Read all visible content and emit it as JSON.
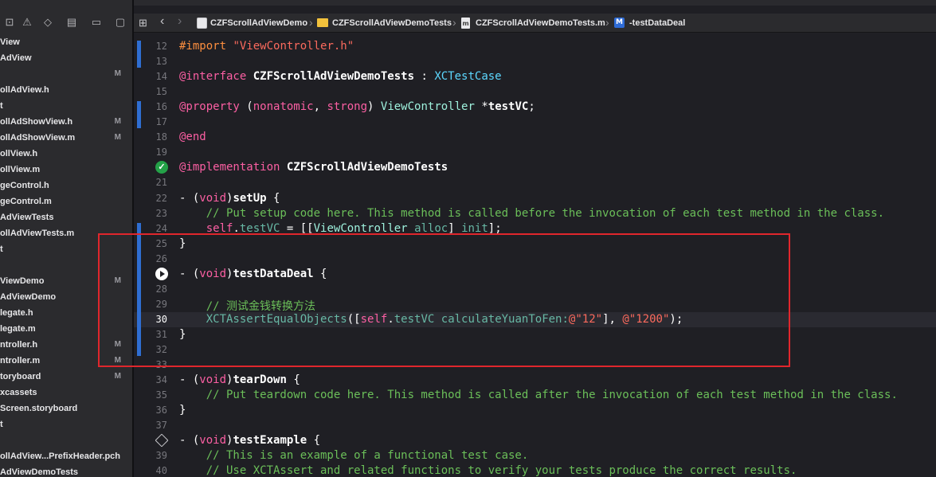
{
  "navigator": {
    "files": [
      {
        "label": "View",
        "status": ""
      },
      {
        "label": "AdView",
        "status": ""
      },
      {
        "label": "",
        "status": "M"
      },
      {
        "label": "ollAdView.h",
        "status": ""
      },
      {
        "label": "t",
        "status": ""
      },
      {
        "label": "ollAdShowView.h",
        "status": "M"
      },
      {
        "label": "ollAdShowView.m",
        "status": "M"
      },
      {
        "label": "ollView.h",
        "status": ""
      },
      {
        "label": "ollView.m",
        "status": ""
      },
      {
        "label": "geControl.h",
        "status": ""
      },
      {
        "label": "geControl.m",
        "status": ""
      },
      {
        "label": "AdViewTests",
        "status": ""
      },
      {
        "label": "ollAdViewTests.m",
        "status": ""
      },
      {
        "label": "t",
        "status": ""
      },
      {
        "label": "",
        "status": ""
      },
      {
        "label": "ViewDemo",
        "status": "M"
      },
      {
        "label": "AdViewDemo",
        "status": ""
      },
      {
        "label": "legate.h",
        "status": ""
      },
      {
        "label": "legate.m",
        "status": ""
      },
      {
        "label": "ntroller.h",
        "status": "M"
      },
      {
        "label": "ntroller.m",
        "status": "M"
      },
      {
        "label": "toryboard",
        "status": "M"
      },
      {
        "label": "xcassets",
        "status": ""
      },
      {
        "label": "Screen.storyboard",
        "status": ""
      },
      {
        "label": "t",
        "status": ""
      },
      {
        "label": "",
        "status": ""
      },
      {
        "label": "ollAdView...PrefixHeader.pch",
        "status": ""
      },
      {
        "label": "AdViewDemoTests",
        "status": ""
      }
    ]
  },
  "jumpbar": {
    "project": "CZFScrollAdViewDemo",
    "folder": "CZFScrollAdViewDemoTests",
    "file": "CZFScrollAdViewDemoTests.m",
    "method_badge": "M",
    "method": "-testDataDeal"
  },
  "editor": {
    "current_line": 30,
    "lines": [
      {
        "n": 12,
        "tokens": [
          [
            "dir",
            "#import "
          ],
          [
            "str",
            "\"ViewController.h\""
          ]
        ]
      },
      {
        "n": 13,
        "tokens": []
      },
      {
        "n": 14,
        "tokens": [
          [
            "kw",
            "@interface "
          ],
          [
            "bold",
            "CZFScrollAdViewDemoTests"
          ],
          [
            "plain",
            " : "
          ],
          [
            "type",
            "XCTestCase"
          ]
        ]
      },
      {
        "n": 15,
        "tokens": []
      },
      {
        "n": 16,
        "tokens": [
          [
            "kw",
            "@property "
          ],
          [
            "plain",
            "("
          ],
          [
            "kw",
            "nonatomic"
          ],
          [
            "plain",
            ", "
          ],
          [
            "kw",
            "strong"
          ],
          [
            "plain",
            ") "
          ],
          [
            "cls",
            "ViewController"
          ],
          [
            "plain",
            " *"
          ],
          [
            "bold",
            "testVC"
          ],
          [
            "plain",
            ";"
          ]
        ]
      },
      {
        "n": 17,
        "tokens": []
      },
      {
        "n": 18,
        "tokens": [
          [
            "kw",
            "@end"
          ]
        ]
      },
      {
        "n": 19,
        "tokens": []
      },
      {
        "n": 20,
        "tokens": [
          [
            "kw",
            "@implementation "
          ],
          [
            "bold",
            "CZFScrollAdViewDemoTests"
          ]
        ]
      },
      {
        "n": 21,
        "tokens": []
      },
      {
        "n": 22,
        "tokens": [
          [
            "plain",
            "- ("
          ],
          [
            "kw",
            "void"
          ],
          [
            "plain",
            ")"
          ],
          [
            "bold",
            "setUp"
          ],
          [
            "plain",
            " {"
          ]
        ]
      },
      {
        "n": 23,
        "tokens": [
          [
            "cmt",
            "    // Put setup code here. This method is called before the invocation of each test method in the class."
          ]
        ]
      },
      {
        "n": 24,
        "tokens": [
          [
            "plain",
            "    "
          ],
          [
            "kw",
            "self"
          ],
          [
            "plain",
            "."
          ],
          [
            "call",
            "testVC"
          ],
          [
            "plain",
            " = [["
          ],
          [
            "cls",
            "ViewController"
          ],
          [
            "plain",
            " "
          ],
          [
            "call",
            "alloc"
          ],
          [
            "plain",
            "] "
          ],
          [
            "call",
            "init"
          ],
          [
            "plain",
            "];"
          ]
        ]
      },
      {
        "n": 25,
        "tokens": [
          [
            "plain",
            "}"
          ]
        ]
      },
      {
        "n": 26,
        "tokens": []
      },
      {
        "n": 27,
        "tokens": [
          [
            "plain",
            "- ("
          ],
          [
            "kw",
            "void"
          ],
          [
            "plain",
            ")"
          ],
          [
            "bold",
            "testDataDeal"
          ],
          [
            "plain",
            " {"
          ]
        ]
      },
      {
        "n": 28,
        "tokens": []
      },
      {
        "n": 29,
        "tokens": [
          [
            "cmt",
            "    // 测试金钱转换方法"
          ]
        ]
      },
      {
        "n": 30,
        "tokens": [
          [
            "plain",
            "    "
          ],
          [
            "call",
            "XCTAssertEqualObjects"
          ],
          [
            "plain",
            "(["
          ],
          [
            "kw",
            "self"
          ],
          [
            "plain",
            "."
          ],
          [
            "call",
            "testVC"
          ],
          [
            "plain",
            " "
          ],
          [
            "call",
            "calculateYuanToFen:"
          ],
          [
            "str",
            "@\"12\""
          ],
          [
            "plain",
            "], "
          ],
          [
            "str",
            "@\"1200\""
          ],
          [
            "plain",
            ");"
          ]
        ]
      },
      {
        "n": 31,
        "tokens": [
          [
            "plain",
            "}"
          ]
        ]
      },
      {
        "n": 32,
        "tokens": []
      },
      {
        "n": 33,
        "tokens": []
      },
      {
        "n": 34,
        "tokens": [
          [
            "plain",
            "- ("
          ],
          [
            "kw",
            "void"
          ],
          [
            "plain",
            ")"
          ],
          [
            "bold",
            "tearDown"
          ],
          [
            "plain",
            " {"
          ]
        ]
      },
      {
        "n": 35,
        "tokens": [
          [
            "cmt",
            "    // Put teardown code here. This method is called after the invocation of each test method in the class."
          ]
        ]
      },
      {
        "n": 36,
        "tokens": [
          [
            "plain",
            "}"
          ]
        ]
      },
      {
        "n": 37,
        "tokens": []
      },
      {
        "n": 38,
        "tokens": [
          [
            "plain",
            "- ("
          ],
          [
            "kw",
            "void"
          ],
          [
            "plain",
            ")"
          ],
          [
            "bold",
            "testExample"
          ],
          [
            "plain",
            " {"
          ]
        ]
      },
      {
        "n": 39,
        "tokens": [
          [
            "cmt",
            "    // This is an example of a functional test case."
          ]
        ]
      },
      {
        "n": 40,
        "tokens": [
          [
            "cmt",
            "    // Use XCTAssert and related functions to verify your tests produce the correct results."
          ]
        ]
      }
    ],
    "badges": {
      "20": "pass",
      "27": "run",
      "38": "diamond"
    }
  },
  "colors": {
    "keyword": "#fc5fa3",
    "string": "#fc6a5d",
    "comment": "#6bbf59",
    "highlight_box": "#e0262c",
    "change_bar": "#2f6ed2"
  }
}
